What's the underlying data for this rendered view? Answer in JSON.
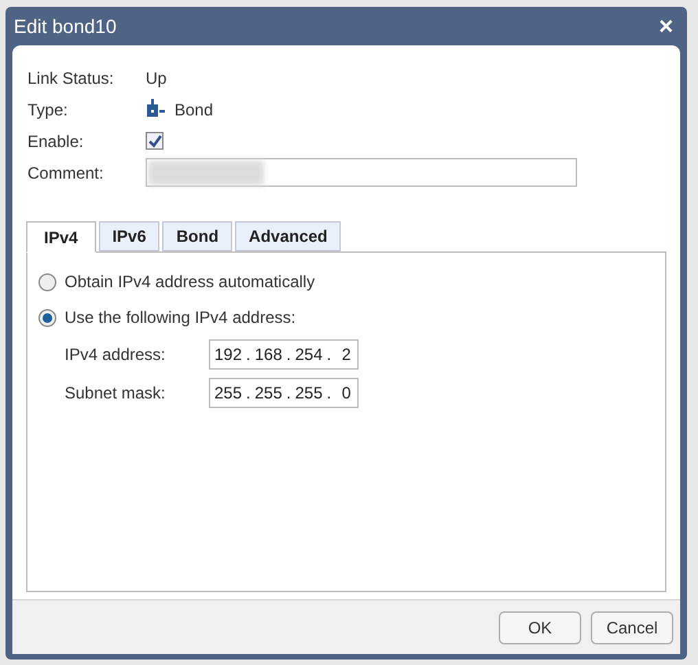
{
  "window": {
    "title": "Edit bond10",
    "close": "×"
  },
  "fields": [
    {
      "kind": "text",
      "label": "Link Status:",
      "value": "Up"
    },
    {
      "kind": "type",
      "label": "Type:",
      "value": "Bond"
    },
    {
      "kind": "checkbox",
      "label": "Enable:",
      "checked": true
    },
    {
      "kind": "input",
      "label": "Comment:"
    }
  ],
  "tabs": [
    {
      "label": "IPv4",
      "selected": true
    },
    {
      "label": "IPv6",
      "selected": false
    },
    {
      "label": "Bond",
      "selected": false
    },
    {
      "label": "Advanced",
      "selected": false
    }
  ],
  "options": [
    {
      "label": "Obtain IPv4 address automatically",
      "selected": false
    },
    {
      "label": "Use the following IPv4 address:",
      "selected": true
    }
  ],
  "addresses": [
    {
      "label": "IPv4 address:",
      "octets": [
        "192",
        "168",
        "254",
        "2"
      ],
      "separators": [
        ".",
        ".",
        "."
      ]
    },
    {
      "label": "Subnet mask:",
      "octets": [
        "255",
        "255",
        "255",
        "0"
      ],
      "separators": [
        ".",
        ".",
        "."
      ]
    }
  ],
  "buttons": [
    "OK",
    "Cancel"
  ]
}
